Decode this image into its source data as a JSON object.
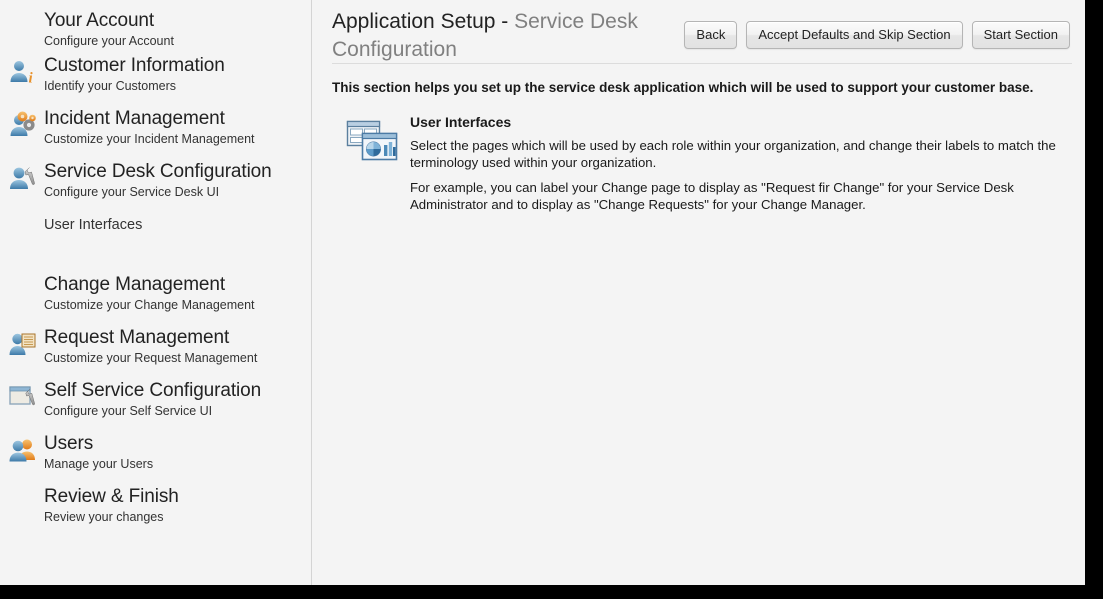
{
  "sidebar": {
    "items": [
      {
        "title": "Your Account",
        "subtitle": "Configure your Account",
        "icon": "none"
      },
      {
        "title": "Customer Information",
        "subtitle": "Identify your Customers",
        "icon": "person-info-icon"
      },
      {
        "title": "Incident Management",
        "subtitle": "Customize your Incident Management",
        "icon": "person-gears-icon"
      },
      {
        "title": "Service Desk Configuration",
        "subtitle": "Configure your Service Desk UI",
        "icon": "person-wrench-icon"
      }
    ],
    "sub_link": "User Interfaces",
    "items_lower": [
      {
        "title": "Change Management",
        "subtitle": "Customize your Change Management",
        "icon": "none"
      },
      {
        "title": "Request Management",
        "subtitle": "Customize your Request Management",
        "icon": "person-document-icon"
      },
      {
        "title": "Self Service Configuration",
        "subtitle": "Configure your Self Service UI",
        "icon": "window-wrench-icon"
      },
      {
        "title": "Users",
        "subtitle": "Manage your Users",
        "icon": "two-people-icon"
      },
      {
        "title": "Review & Finish",
        "subtitle": "Review your changes",
        "icon": "none"
      }
    ]
  },
  "header": {
    "title_strong": "Application Setup - ",
    "title_muted": "Service Desk Configuration",
    "buttons": [
      {
        "label": "Back",
        "name": "back-button"
      },
      {
        "label": "Accept Defaults and Skip Section",
        "name": "accept-defaults-skip-section-button"
      },
      {
        "label": "Start Section",
        "name": "start-section-button"
      }
    ]
  },
  "main": {
    "intro": "This section helps you set up the service desk application which will be used to support your customer base.",
    "section": {
      "icon": "user-interfaces-icon",
      "heading": "User Interfaces",
      "paragraph1": "Select the pages which will be used by each role within your organization, and change their labels to match the terminology used within your organization.",
      "paragraph2": "For example, you can label your Change page to display as \"Request fir Change\" for your Service Desk Administrator and to display as \"Change Requests\" for your Change Manager."
    }
  },
  "colors": {
    "page_bg": "#f4f4f4",
    "text": "#1a1a1a",
    "muted": "#808080",
    "divider": "#dcdcdc",
    "gutter": "#000000",
    "icon_blue": "#4a86b8",
    "icon_orange": "#e8923a"
  }
}
